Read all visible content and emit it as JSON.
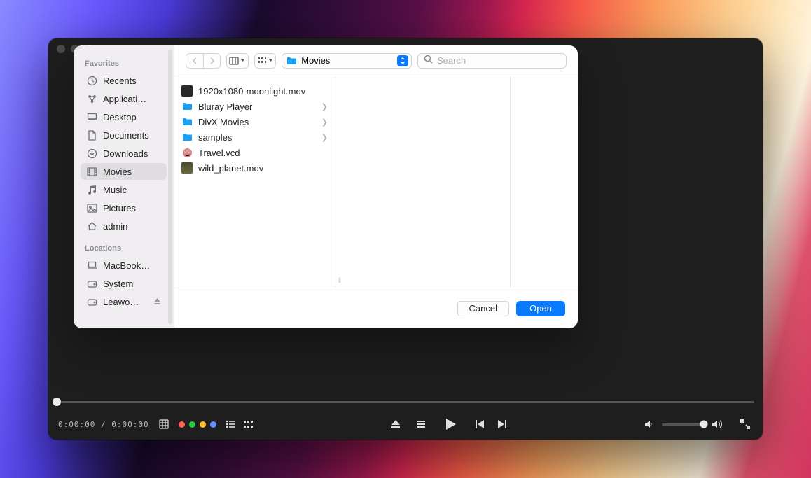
{
  "player": {
    "time_current": "0:00:00",
    "time_sep": " / ",
    "time_total": "0:00:00"
  },
  "dots": [
    "#ff5f57",
    "#28c840",
    "#ffbd2e",
    "#6b8cff"
  ],
  "dialog": {
    "sidebar": {
      "favorites_label": "Favorites",
      "favorites": [
        {
          "icon": "clock",
          "label": "Recents"
        },
        {
          "icon": "apps",
          "label": "Applicati…"
        },
        {
          "icon": "desktop",
          "label": "Desktop"
        },
        {
          "icon": "doc",
          "label": "Documents"
        },
        {
          "icon": "download",
          "label": "Downloads"
        },
        {
          "icon": "movie",
          "label": "Movies",
          "selected": true
        },
        {
          "icon": "music",
          "label": "Music"
        },
        {
          "icon": "pictures",
          "label": "Pictures"
        },
        {
          "icon": "home",
          "label": "admin"
        }
      ],
      "locations_label": "Locations",
      "locations": [
        {
          "icon": "laptop",
          "label": "MacBook…"
        },
        {
          "icon": "disk",
          "label": "System"
        },
        {
          "icon": "disk",
          "label": "Leawo…",
          "eject": true
        }
      ]
    },
    "location_name": "Movies",
    "search_placeholder": "Search",
    "files": [
      {
        "type": "mov",
        "name": "1920x1080-moonlight.mov",
        "chevron": false
      },
      {
        "type": "folder",
        "name": "Bluray Player",
        "chevron": true
      },
      {
        "type": "folder",
        "name": "DivX Movies",
        "chevron": true
      },
      {
        "type": "folder",
        "name": "samples",
        "chevron": true
      },
      {
        "type": "vcd",
        "name": "Travel.vcd",
        "chevron": false
      },
      {
        "type": "wild",
        "name": "wild_planet.mov",
        "chevron": false
      }
    ],
    "cancel_label": "Cancel",
    "open_label": "Open"
  }
}
